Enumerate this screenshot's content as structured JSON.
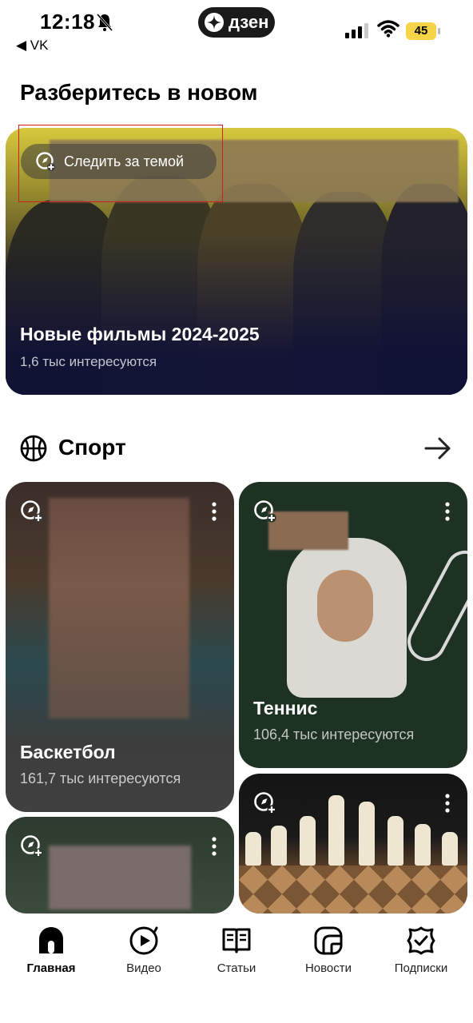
{
  "status_bar": {
    "time": "12:18",
    "back_app": "◀ VK",
    "center_app": "дзен",
    "battery": "45"
  },
  "section_new": {
    "title": "Разберитесь в новом",
    "card": {
      "follow_label": "Следить за темой",
      "title": "Новые фильмы 2024-2025",
      "subtitle": "1,6 тыс интересуются"
    }
  },
  "section_sport": {
    "title": "Спорт",
    "cards": [
      {
        "title": "Баскетбол",
        "subtitle": "161,7 тыс интересуются"
      },
      {
        "title": "Теннис",
        "subtitle": "106,4 тыс интересуются"
      }
    ]
  },
  "tabbar": {
    "items": [
      {
        "label": "Главная",
        "icon": "home-icon",
        "active": true
      },
      {
        "label": "Видео",
        "icon": "video-icon",
        "active": false
      },
      {
        "label": "Статьи",
        "icon": "articles-icon",
        "active": false
      },
      {
        "label": "Новости",
        "icon": "news-icon",
        "active": false
      },
      {
        "label": "Подписки",
        "icon": "subscriptions-icon",
        "active": false
      }
    ]
  },
  "colors": {
    "battery": "#f5d547",
    "hero_dark": "#171a3a",
    "tennis_card": "#1e3224",
    "selection_frame": "#d21e1e"
  }
}
